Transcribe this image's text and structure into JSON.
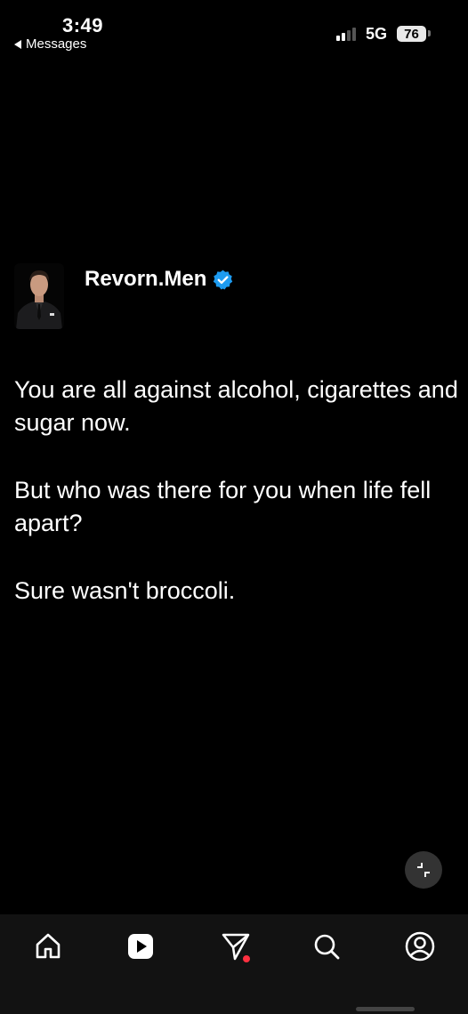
{
  "status_bar": {
    "time": "3:49",
    "back_app": "Messages",
    "network": "5G",
    "battery": "76"
  },
  "post": {
    "author": "Revorn.Men",
    "verified": true,
    "paragraphs": [
      "You are all against alcohol, cigarettes and sugar now.",
      "But who was there for you when life fell apart?",
      "Sure wasn't broccoli."
    ]
  },
  "bottom_nav": {
    "items": [
      {
        "icon": "home-icon"
      },
      {
        "icon": "play-icon"
      },
      {
        "icon": "send-icon",
        "notification_dot": true
      },
      {
        "icon": "search-icon"
      },
      {
        "icon": "profile-icon"
      }
    ]
  },
  "colors": {
    "background": "#000000",
    "nav_background": "#121212",
    "verified_blue": "#1d9bf0",
    "notification_red": "#ff3040"
  }
}
